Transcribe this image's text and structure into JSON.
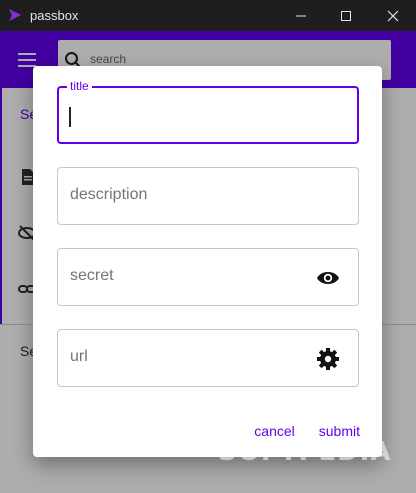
{
  "window": {
    "title": "passbox"
  },
  "appbar": {
    "search_placeholder": "search"
  },
  "drawer": {
    "section_top": "Se",
    "section_bottom": "Se"
  },
  "dialog": {
    "title_label": "title",
    "title_value": "",
    "description_placeholder": "description",
    "secret_placeholder": "secret",
    "url_placeholder": "url",
    "cancel_label": "cancel",
    "submit_label": "submit"
  },
  "watermark": "SOFTPEDIA",
  "colors": {
    "accent": "#6200ee",
    "titlebar": "#1e1e1e"
  }
}
